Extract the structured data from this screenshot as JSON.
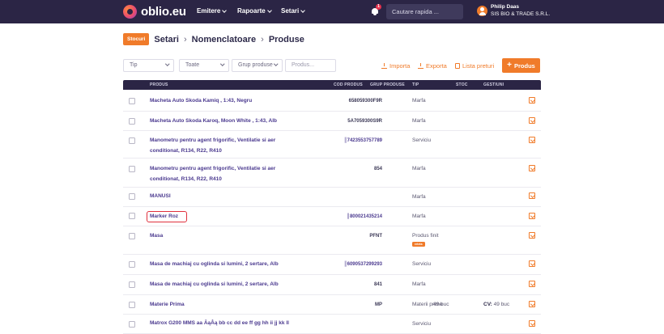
{
  "app": {
    "logo_text": "oblio.eu",
    "nav": [
      {
        "label": "Emitere"
      },
      {
        "label": "Rapoarte"
      },
      {
        "label": "Setari"
      }
    ],
    "notifications_count": "1",
    "quick_search_placeholder": "Cautare rapida ...",
    "user": {
      "name": "Philip Daas",
      "company": "SIS BIO & TRADE S.R.L."
    },
    "accent_color": "#f07b2a",
    "nav_color": "#2b2545"
  },
  "breadcrumb": {
    "badge": "Stocuri",
    "items": [
      "Setari",
      "Nomenclatoare",
      "Produse"
    ],
    "separator": "›"
  },
  "filters": {
    "tip": "Tip",
    "toate": "Toate",
    "grup": "Grup produse",
    "produs_placeholder": "Produs..."
  },
  "actions": {
    "importa": "Importa",
    "exporta": "Exporta",
    "lista_preturi": "Lista preturi",
    "add_button": "Produs"
  },
  "table": {
    "headers": {
      "produs": "Produs",
      "cod_produs": "Cod produs",
      "grup_produse": "Grup produse",
      "tip": "Tip",
      "stoc": "Stoc",
      "gestiuni": "Gestiuni"
    },
    "rows": [
      {
        "name": "Macheta Auto Skoda Kamiq , 1:43, Negru",
        "code": "658059300F9R",
        "tip": "Marfa"
      },
      {
        "name": "Macheta Auto Skoda Karoq, Moon White , 1:43, Alb",
        "code": "5A7059300S9R",
        "tip": "Marfa"
      },
      {
        "name": "Manometru pentru agent frigorific, Ventilatie si aer conditionat, R134, R22, R410",
        "code": "7423553757789",
        "tip": "Serviciu"
      },
      {
        "name": "Manometru pentru agent frigorific, Ventilatie si aer conditionat, R134, R22, R410",
        "code": "854",
        "tip": "Marfa"
      },
      {
        "name": "MANUSI",
        "code": "",
        "tip": "Marfa"
      },
      {
        "name": "Marker Roz",
        "code": "800021435214",
        "tip": "Marfa"
      },
      {
        "name": "Masa",
        "code": "PFNT",
        "tip": "Produs finit",
        "badge": "reteta"
      },
      {
        "name": "Masa de machiaj cu oglinda si lumini, 2 sertare, Alb",
        "code": "6090537299293",
        "tip": "Serviciu"
      },
      {
        "name": "Masa de machiaj cu oglinda si lumini, 2 sertare, Alb",
        "code": "841",
        "tip": "Marfa"
      },
      {
        "name": "Materie Prima",
        "code": "MP",
        "tip": "Materii prime",
        "stoc": "49 buc",
        "gestiune_label": "CV:",
        "gestiune_value": "49 buc"
      },
      {
        "name": "Matrox G200 MMS aa ĂąÂą bb cc dd ee ff gg hh ii jj kk ll",
        "code": "",
        "tip": "Serviciu"
      }
    ]
  }
}
